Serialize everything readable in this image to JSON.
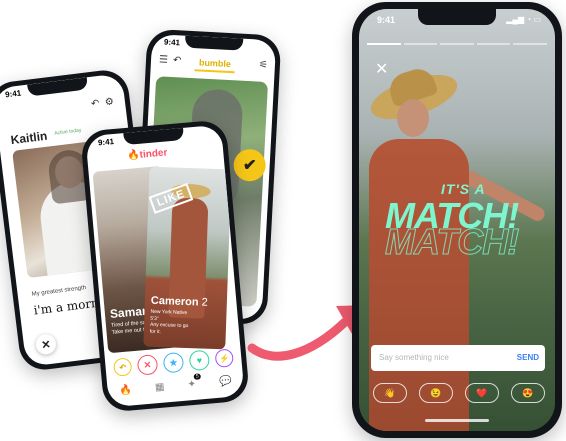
{
  "colors": {
    "tinder": "#fd5068",
    "bumble": "#f5c518",
    "hinge_green": "#4caf50",
    "match_mint": "#7ff5cf",
    "arrow": "#ee5a6f"
  },
  "hinge": {
    "time": "9:41",
    "name": "Kaitlin",
    "status": "Active today",
    "prompt_label": "My greatest strength",
    "prompt_answer": "i'm a morn",
    "icons": [
      "undo-icon",
      "settings-icon",
      "close-icon"
    ]
  },
  "bumble": {
    "time": "9:41",
    "logo": "bumble",
    "icons": [
      "menu-icon",
      "back-icon",
      "filter-icon",
      "check-icon"
    ]
  },
  "tinder": {
    "time": "9:41",
    "logo": "tinder",
    "stamp": "LIKE",
    "left_card": {
      "name": "Samantha",
      "bio": "Tired of the same\nTake me out to dinner"
    },
    "right_card": {
      "name": "Cameron",
      "age": "2",
      "bio": "New York Native\n5'3\"\nAny excuse to go\nfor it."
    },
    "actions": [
      "rewind-icon",
      "nope-icon",
      "superlike-icon",
      "like-icon",
      "boost-icon"
    ],
    "nav": [
      "flame-icon",
      "explore-icon",
      "spark-icon",
      "chat-icon"
    ],
    "badge": "5"
  },
  "match_phone": {
    "time": "9:41",
    "its_a": "IT'S A",
    "match": "MATCH!",
    "input_placeholder": "Say something nice",
    "send": "SEND",
    "reactions": [
      "👋",
      "😉",
      "❤️",
      "😍"
    ]
  }
}
